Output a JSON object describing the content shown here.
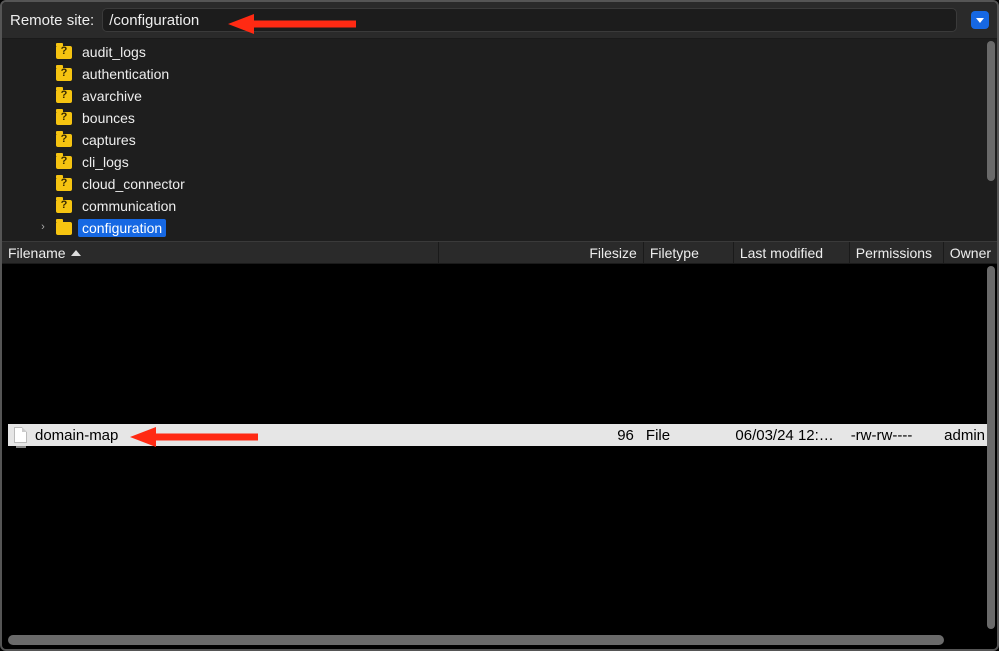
{
  "addressbar": {
    "label": "Remote site:",
    "path": "/configuration"
  },
  "tree": {
    "items": [
      {
        "name": "audit_logs",
        "unknown": true,
        "expandable": false,
        "selected": false
      },
      {
        "name": "authentication",
        "unknown": true,
        "expandable": false,
        "selected": false
      },
      {
        "name": "avarchive",
        "unknown": true,
        "expandable": false,
        "selected": false
      },
      {
        "name": "bounces",
        "unknown": true,
        "expandable": false,
        "selected": false
      },
      {
        "name": "captures",
        "unknown": true,
        "expandable": false,
        "selected": false
      },
      {
        "name": "cli_logs",
        "unknown": true,
        "expandable": false,
        "selected": false
      },
      {
        "name": "cloud_connector",
        "unknown": true,
        "expandable": false,
        "selected": false
      },
      {
        "name": "communication",
        "unknown": true,
        "expandable": false,
        "selected": false
      },
      {
        "name": "configuration",
        "unknown": false,
        "expandable": true,
        "selected": true
      }
    ]
  },
  "columns": {
    "name": "Filename",
    "size": "Filesize",
    "type": "Filetype",
    "modified": "Last modified",
    "permissions": "Permissions",
    "owner": "Owner"
  },
  "files": {
    "parent": "..",
    "rows": [
      {
        "name": "domain-map",
        "size": "96",
        "type": "File",
        "modified": "06/03/24 12:…",
        "permissions": "-rw-rw----",
        "owner": "admin",
        "selected": true
      }
    ]
  },
  "annotations": {
    "arrow_color": "#ff2a13"
  }
}
